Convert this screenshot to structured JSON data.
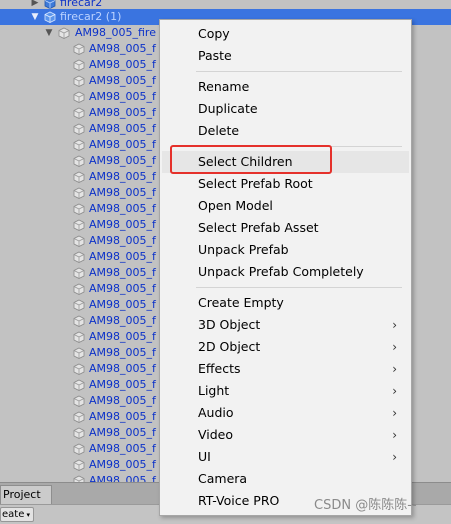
{
  "hierarchy": {
    "parent_above": "firecar2",
    "selected_label": "firecar2 (1)",
    "child_label": "AM98_005_fire",
    "rows": [
      "AM98_005_f",
      "AM98_005_f",
      "AM98_005_f",
      "AM98_005_f",
      "AM98_005_f",
      "AM98_005_f",
      "AM98_005_f",
      "AM98_005_f",
      "AM98_005_f",
      "AM98_005_f",
      "AM98_005_f",
      "AM98_005_f",
      "AM98_005_f",
      "AM98_005_f",
      "AM98_005_f",
      "AM98_005_f",
      "AM98_005_f",
      "AM98_005_f",
      "AM98_005_f",
      "AM98_005_f",
      "AM98_005_f",
      "AM98_005_f",
      "AM98_005_f",
      "AM98_005_f",
      "AM98_005_f",
      "AM98_005_f",
      "AM98_005_f",
      "AM98_005_f"
    ]
  },
  "context_menu": {
    "groups": [
      [
        "Copy",
        "Paste"
      ],
      [
        "Rename",
        "Duplicate",
        "Delete"
      ],
      [
        "Select Children",
        "Select Prefab Root",
        "Open Model",
        "Select Prefab Asset",
        "Unpack Prefab",
        "Unpack Prefab Completely"
      ],
      [
        "Create Empty",
        "3D Object",
        "2D Object",
        "Effects",
        "Light",
        "Audio",
        "Video",
        "UI",
        "Camera",
        "RT-Voice PRO"
      ]
    ],
    "submenu_items": [
      "3D Object",
      "2D Object",
      "Effects",
      "Light",
      "Audio",
      "Video",
      "UI"
    ],
    "highlighted_item": "Select Children",
    "submenu_arrow": "›"
  },
  "bottom": {
    "project_tab": "Project",
    "create_button": "eate",
    "create_caret": "▾"
  },
  "watermark": "CSDN @陈陈陈--",
  "colors": {
    "hierarchy_text": "#0b31c9",
    "selection": "#3a74e0",
    "highlight_box": "#e5312b"
  }
}
